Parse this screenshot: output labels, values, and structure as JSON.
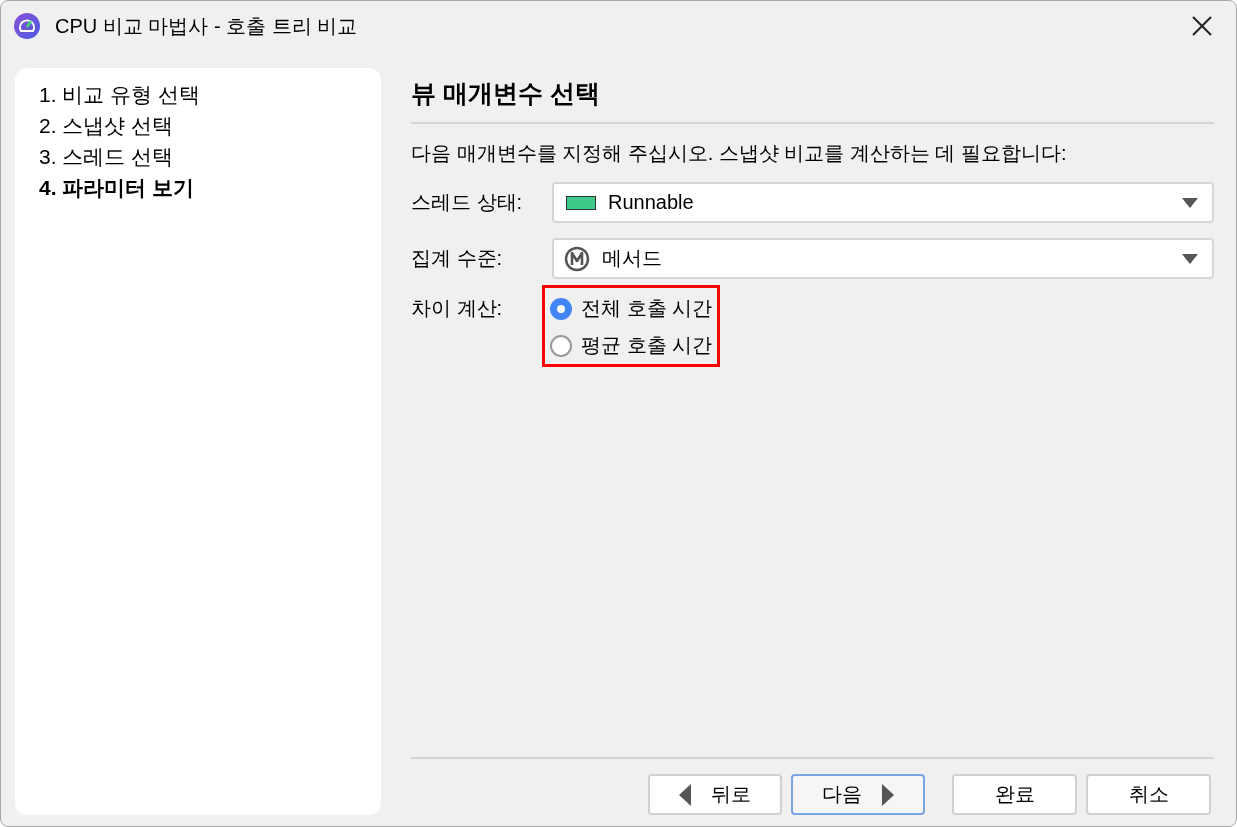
{
  "window": {
    "title": "CPU 비교 마법사 - 호출 트리 비교"
  },
  "steps": [
    {
      "label": "1. 비교 유형 선택",
      "selected": false
    },
    {
      "label": "2. 스냅샷 선택",
      "selected": false
    },
    {
      "label": "3. 스레드 선택",
      "selected": false
    },
    {
      "label": "4. 파라미터 보기",
      "selected": true
    }
  ],
  "heading": "뷰 매개변수 선택",
  "description": "다음 매개변수를 지정해 주십시오. 스냅샷 비교를 계산하는 데 필요합니다:",
  "fields": [
    {
      "label": "스레드 상태:",
      "kind": "swatch",
      "value": "Runnable"
    },
    {
      "label": "집계 수준:",
      "kind": "method",
      "value": "메서드"
    }
  ],
  "difference": {
    "label": "차이 계산:",
    "highlighted": true,
    "options": [
      {
        "label": "전체 호출 시간",
        "selected": true
      },
      {
        "label": "평균 호출 시간",
        "selected": false
      }
    ]
  },
  "buttons": [
    {
      "label": "뒤로",
      "kind": "back",
      "focused": false
    },
    {
      "label": "다음",
      "kind": "next",
      "focused": true
    },
    {
      "label": "완료",
      "kind": "plain",
      "focused": false
    },
    {
      "label": "취소",
      "kind": "plain",
      "focused": false
    }
  ]
}
